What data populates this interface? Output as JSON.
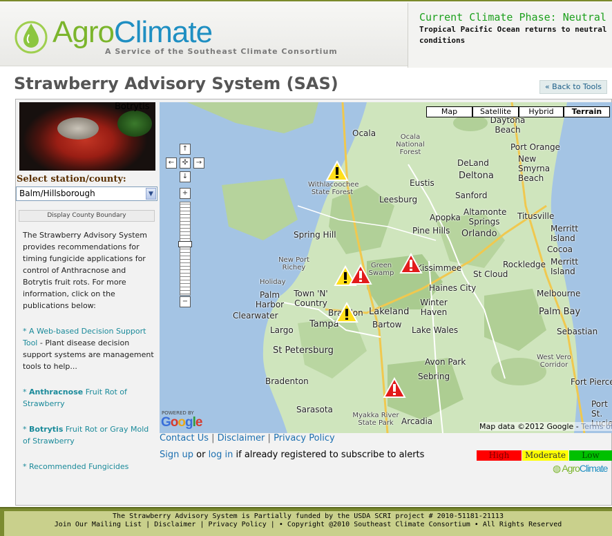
{
  "header": {
    "logo_agro": "Agro",
    "logo_climate": "Climate",
    "logo_subtitle": "A Service of the Southeast Climate Consortium",
    "phase_title": "Current Climate Phase: Neutral",
    "phase_text": "Tropical Pacific Ocean returns to neutral conditions"
  },
  "page": {
    "title": "Strawberry Advisory System (SAS)",
    "back_to_tools": "« Back to Tools"
  },
  "sidebar": {
    "photo_label": "Botrytis",
    "select_label": "Select station/county:",
    "selected_station": "Balm/Hillsborough",
    "boundary_button": "Display County Boundary",
    "intro": "The Strawberry Advisory System provides recommendations for timing fungicide applications for control of Anthracnose and Botrytis fruit rots. For more information, click on the publications below:",
    "publications": [
      {
        "prefix": "* ",
        "link": "A Web-based Decision Support Tool",
        "rest": " - Plant disease decision support systems are management tools to help..."
      },
      {
        "prefix": "* ",
        "bold": "Anthracnose",
        "link": " Fruit Rot of Strawberry"
      },
      {
        "prefix": "* ",
        "bold": "Botrytis",
        "link": " Fruit Rot or Gray Mold of Strawberry"
      },
      {
        "prefix": "* ",
        "link": "Recommended Fungicides"
      }
    ]
  },
  "map": {
    "types": [
      "Map",
      "Satellite",
      "Hybrid",
      "Terrain"
    ],
    "selected_type": "Terrain",
    "cities": [
      "Ocala",
      "Ocala National Forest",
      "Daytona Beach",
      "Port Orange",
      "New Smyrna Beach",
      "DeLand",
      "Deltona",
      "Withlacoochee State Forest",
      "Eustis",
      "Leesburg",
      "Sanford",
      "Altamonte Springs",
      "Apopka",
      "Titusville",
      "Pine Hills",
      "Orlando",
      "Spring Hill",
      "Merritt Island",
      "Cocoa",
      "New Port Richey",
      "Green Swamp",
      "Kissimmee",
      "Rockledge",
      "Merritt Island",
      "Holiday",
      "Haines City",
      "St Cloud",
      "Palm Harbor",
      "Town 'N' Country",
      "Winter Haven",
      "Melbourne",
      "Clearwater",
      "Brandon",
      "Lakeland",
      "Palm Bay",
      "Tampa",
      "Bartow",
      "Largo",
      "Lake Wales",
      "Sebastian",
      "St Petersburg",
      "Avon Park",
      "West Vero Corridor",
      "Sebring",
      "Bradenton",
      "Fort Pierce",
      "Sarasota",
      "Port St. Lucie",
      "Myakka River State Park",
      "Arcadia"
    ],
    "powered_by": "POWERED BY",
    "google_letters": [
      "G",
      "o",
      "o",
      "g",
      "l",
      "e"
    ],
    "credit": "Map data ©2012 Google - ",
    "terms": "Terms of Use",
    "warnings": [
      {
        "level": "moderate",
        "color": "#ffdf1a"
      },
      {
        "level": "moderate",
        "color": "#ffdf1a"
      },
      {
        "level": "high",
        "color": "#e21b1b"
      },
      {
        "level": "high",
        "color": "#e21b1b"
      },
      {
        "level": "moderate",
        "color": "#ffdf1a"
      },
      {
        "level": "high",
        "color": "#e21b1b"
      }
    ]
  },
  "links": {
    "contact": "Contact Us",
    "disclaimer": "Disclaimer",
    "privacy": "Privacy Policy",
    "sep": " | ",
    "signup": "Sign up",
    "or": " or ",
    "login": "log in",
    "signup_rest": " if already registered to subscribe to alerts"
  },
  "legend": {
    "high": "High",
    "moderate": "Moderate",
    "low": "Low",
    "high_color": "#ff0000",
    "moderate_color": "#ffff00",
    "low_color": "#00c000"
  },
  "small_logo": {
    "agro": "Agro",
    "climate": "Climate"
  },
  "footer": {
    "line1": "The Strawberry Advisory System is Partially funded by the USDA SCRI project # 2010-51181-21113",
    "line2": "Join Our Mailing List | Disclaimer | Privacy Policy | • Copyright @2010 Southeast Climate Consortium • All Rights Reserved"
  }
}
